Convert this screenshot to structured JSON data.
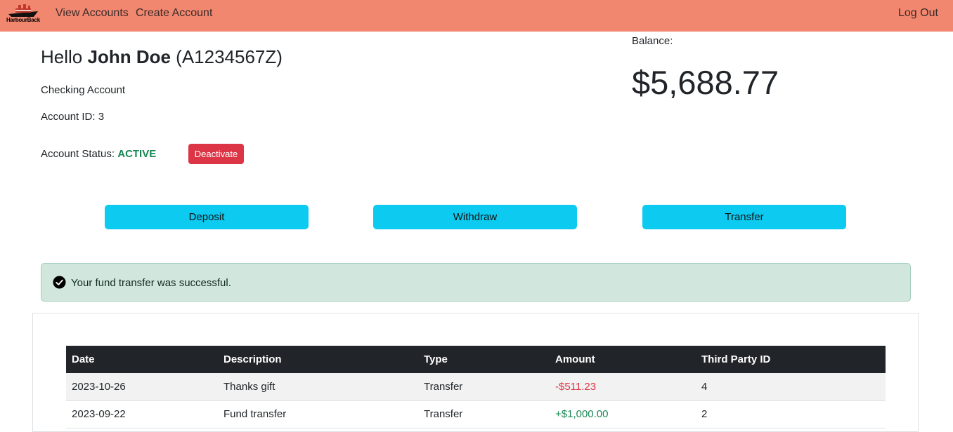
{
  "navbar": {
    "logo_text": "HarbourBack",
    "links": {
      "view_accounts": "View Accounts",
      "create_account": "Create Account",
      "log_out": "Log Out"
    }
  },
  "account": {
    "greeting_prefix": "Hello ",
    "name": "John Doe",
    "customer_id": "(A1234567Z)",
    "type": "Checking Account",
    "id_label": "Account ID: ",
    "id": "3",
    "status_label": "Account Status: ",
    "status": "ACTIVE",
    "deactivate_label": "Deactivate"
  },
  "balance": {
    "label": "Balance:",
    "value": "$5,688.77"
  },
  "actions": {
    "deposit": "Deposit",
    "withdraw": "Withdraw",
    "transfer": "Transfer"
  },
  "alert": {
    "message": "Your fund transfer was successful."
  },
  "transactions": {
    "headers": [
      "Date",
      "Description",
      "Type",
      "Amount",
      "Third Party ID"
    ],
    "rows": [
      {
        "date": "2023-10-26",
        "description": "Thanks gift",
        "type": "Transfer",
        "amount": "-$511.23",
        "third_party_id": "4"
      },
      {
        "date": "2023-09-22",
        "description": "Fund transfer",
        "type": "Transfer",
        "amount": "+$1,000.00",
        "third_party_id": "2"
      }
    ]
  },
  "colors": {
    "navbar": "#f28770",
    "action_button": "#0dcaf0",
    "danger": "#dc3545",
    "success": "#198754",
    "alert_bg": "#d1e7dd",
    "table_header": "#212529"
  }
}
